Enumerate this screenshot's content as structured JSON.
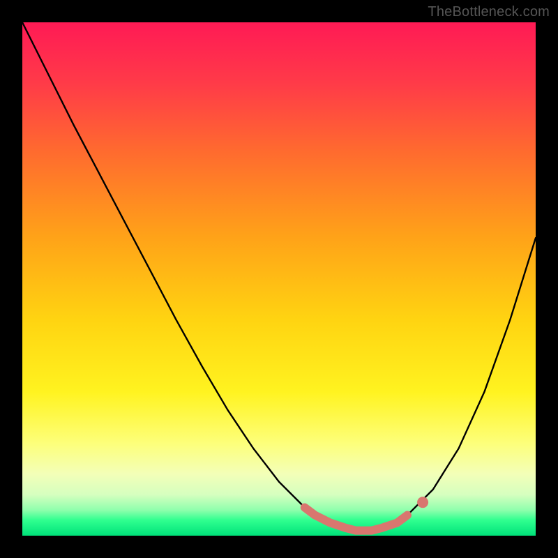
{
  "watermark": "TheBottleneck.com",
  "colors": {
    "frame": "#000000",
    "curve": "#000000",
    "accent_dots": "#d9766f"
  },
  "chart_data": {
    "type": "line",
    "title": "",
    "xlabel": "",
    "ylabel": "",
    "xlim": [
      0,
      100
    ],
    "ylim": [
      0,
      100
    ],
    "series": [
      {
        "name": "bottleneck-curve",
        "x": [
          0,
          5,
          10,
          15,
          20,
          25,
          30,
          35,
          40,
          45,
          50,
          55,
          57,
          60,
          63,
          65,
          68,
          70,
          73,
          75,
          80,
          85,
          90,
          95,
          100
        ],
        "y": [
          100,
          90,
          80,
          70.5,
          61,
          51.5,
          42,
          33,
          24.5,
          17,
          10.5,
          5.5,
          4,
          2.5,
          1.5,
          1,
          1,
          1.5,
          2.5,
          4,
          9,
          17,
          28,
          42,
          58
        ]
      }
    ],
    "accent_segment": {
      "name": "optimal-range",
      "x": [
        55,
        57,
        60,
        63,
        65,
        68,
        70,
        73,
        75
      ],
      "y": [
        5.5,
        4,
        2.5,
        1.5,
        1,
        1,
        1.5,
        2.5,
        4
      ]
    },
    "accent_marker": {
      "x": 78,
      "y": 6.5
    }
  }
}
